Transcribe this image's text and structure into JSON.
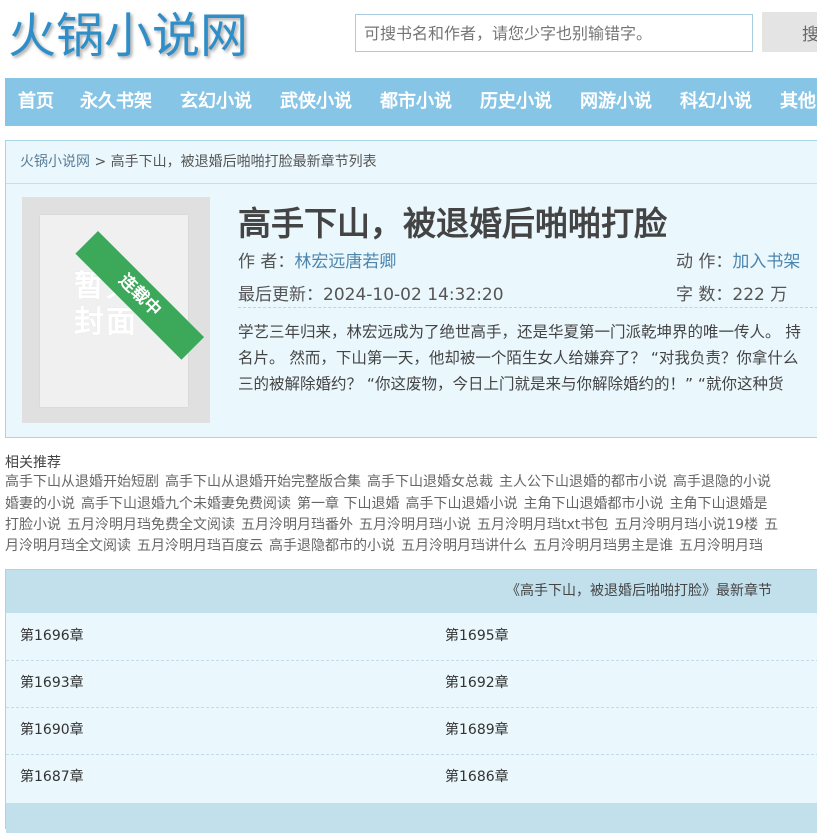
{
  "site": {
    "logo": "火锅小说网"
  },
  "search": {
    "placeholder": "可搜书名和作者，请您少字也别输错字。",
    "button_label": "搜"
  },
  "nav": {
    "items": [
      "首页",
      "永久书架",
      "玄幻小说",
      "武侠小说",
      "都市小说",
      "历史小说",
      "网游小说",
      "科幻小说",
      "其他"
    ]
  },
  "breadcrumb": {
    "home": "火锅小说网",
    "separator": " > ",
    "current": "高手下山，被退婚后啪啪打脸最新章节列表"
  },
  "book": {
    "cover_text": "暂无封面",
    "cover_badge": "连载中",
    "title": "高手下山，被退婚后啪啪打脸",
    "author_label": "作    者：",
    "author": "林宏远唐若卿",
    "action_label": "动    作：",
    "action": "加入书架",
    "updated_label": "最后更新：",
    "updated": "2024-10-02 14:32:20",
    "words_label": "字    数：",
    "words": "222 万",
    "intro_lines": [
      "学艺三年归来，林宏远成为了绝世高手，还是华夏第一门派乾坤界的唯一传人。 持",
      "名片。 然而，下山第一天，他却被一个陌生女人给嫌弃了？ “对我负责？你拿什么",
      "三的被解除婚约？ “你这废物，今日上门就是来与你解除婚约的！” “就你这种货"
    ]
  },
  "recommend": {
    "title": "相关推荐",
    "lines": [
      [
        "高手下山从退婚开始短剧",
        "高手下山从退婚开始完整版合集",
        "高手下山退婚女总裁",
        "主人公下山退婚的都市小说",
        "高手退隐的小说"
      ],
      [
        "婚妻的小说",
        "高手下山退婚九个未婚妻免费阅读",
        "第一章 下山退婚",
        "高手下山退婚小说",
        "主角下山退婚都市小说",
        "主角下山退婚是"
      ],
      [
        "打脸小说",
        "五月泠明月珰免费全文阅读",
        "五月泠明月珰番外",
        "五月泠明月珰小说",
        "五月泠明月珰txt书包",
        "五月泠明月珰小说19楼",
        "五"
      ],
      [
        "月泠明月珰全文阅读",
        "五月泠明月珰百度云",
        "高手退隐都市的小说",
        "五月泠明月珰讲什么",
        "五月泠明月珰男主是谁",
        "五月泠明月珰"
      ]
    ]
  },
  "chapters": {
    "header": "《高手下山，被退婚后啪啪打脸》最新章节",
    "rows": [
      [
        "第1696章",
        "第1695章"
      ],
      [
        "第1693章",
        "第1692章"
      ],
      [
        "第1690章",
        "第1689章"
      ],
      [
        "第1687章",
        "第1686章"
      ]
    ]
  }
}
